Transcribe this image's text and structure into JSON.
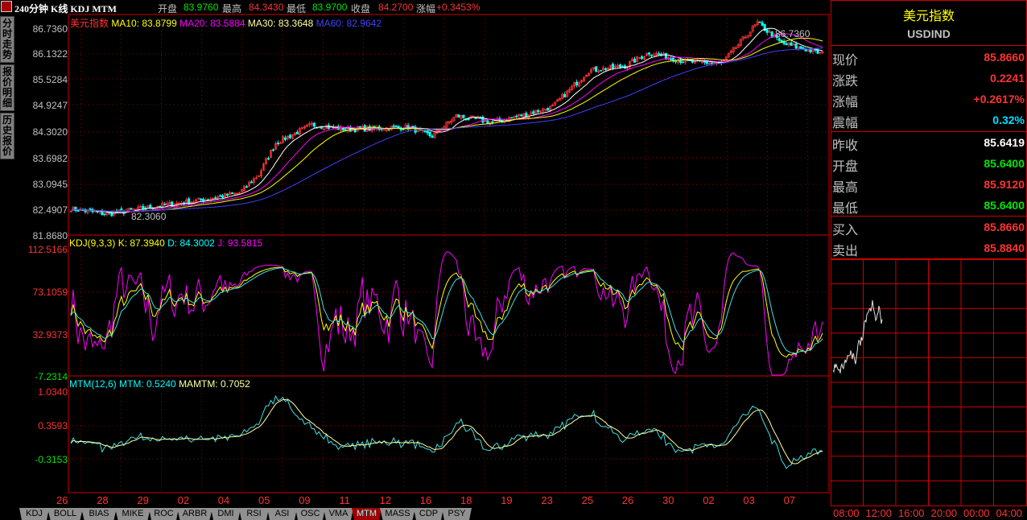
{
  "header": {
    "title": "240分钟 K线 KDJ MTM",
    "open_label": "开盘",
    "open": "83.9760",
    "high_label": "最高",
    "high": "84.3430",
    "low_label": "最低",
    "low": "83.9700",
    "close_label": "收盘",
    "close": "84.2700",
    "change_label": "涨幅",
    "change": "+0.3453%"
  },
  "side_tabs": [
    "分时走势",
    "报价明细",
    "历史报价"
  ],
  "price_panel": {
    "name": "美元指数",
    "ma10": "MA10: 83.8799",
    "ma20": "MA20: 83.5884",
    "ma30": "MA30: 83.3648",
    "ma60": "MA60: 82.9642",
    "axis": [
      "86.7360",
      "86.1322",
      "85.5284",
      "84.9247",
      "84.3020",
      "83.6982",
      "83.0945",
      "82.4907",
      "81.8680"
    ],
    "high_marker": "86.7360",
    "low_marker": "82.3060"
  },
  "kdj_panel": {
    "title": "KDJ(9,3,3)",
    "k": "K: 87.3940",
    "d": "D: 84.3002",
    "j": "J: 93.5815",
    "axis": [
      "112.5166",
      "73.1059",
      "32.9373",
      "-7.2314"
    ]
  },
  "mtm_panel": {
    "title": "MTM(12,6)",
    "mtm": "MTM: 0.5240",
    "mamtm": "MAMTM: 0.7052",
    "axis": [
      "1.0340",
      "0.3593",
      "-0.3153"
    ]
  },
  "dates": [
    "26",
    "28",
    "29",
    "02",
    "04",
    "05",
    "09",
    "11",
    "12",
    "16",
    "18",
    "19",
    "23",
    "25",
    "26",
    "30",
    "02",
    "03",
    "07"
  ],
  "indicator_tabs": [
    "KDJ",
    "BOLL",
    "BIAS",
    "MIKE",
    "ROC",
    "ARBR",
    "DMI",
    "RSI",
    "ASI",
    "OSC",
    "VMA",
    "MTM",
    "MASS",
    "CDP",
    "PSY"
  ],
  "active_tab": "MTM",
  "quote": {
    "name": "美元指数",
    "code": "USDIND",
    "rows": [
      {
        "k": "现价",
        "v": "85.8660",
        "c": "#ff3232"
      },
      {
        "k": "涨跌",
        "v": "0.2241",
        "c": "#ff3232"
      },
      {
        "k": "涨幅",
        "v": "+0.2617%",
        "c": "#ff3232"
      },
      {
        "k": "震幅",
        "v": "0.32%",
        "c": "#00e0ff"
      },
      {
        "k": "昨收",
        "v": "85.6419",
        "c": "#ffffff"
      },
      {
        "k": "开盘",
        "v": "85.6400",
        "c": "#00e600"
      },
      {
        "k": "最高",
        "v": "85.9120",
        "c": "#ff3232"
      },
      {
        "k": "最低",
        "v": "85.6400",
        "c": "#00e600"
      },
      {
        "k": "买入",
        "v": "85.8660",
        "c": "#ff3232"
      },
      {
        "k": "卖出",
        "v": "85.8840",
        "c": "#ff3232"
      }
    ]
  },
  "mini_times": [
    "08:00",
    "12:00",
    "16:00",
    "20:00",
    "00:00",
    "04:00"
  ],
  "chart_data": {
    "type": "candlestick",
    "price_range": [
      81.868,
      86.736
    ],
    "kdj_range": [
      -7.2314,
      112.5166
    ],
    "mtm_range": [
      -1.0,
      1.034
    ],
    "price_path": [
      [
        0,
        82.45
      ],
      [
        15,
        82.33
      ],
      [
        35,
        82.5
      ],
      [
        55,
        82.65
      ],
      [
        70,
        82.8
      ],
      [
        78,
        83.2
      ],
      [
        85,
        83.9
      ],
      [
        100,
        84.3
      ],
      [
        115,
        84.2
      ],
      [
        140,
        84.25
      ],
      [
        150,
        84.05
      ],
      [
        160,
        84.5
      ],
      [
        175,
        84.35
      ],
      [
        190,
        84.55
      ],
      [
        200,
        84.7
      ],
      [
        215,
        85.5
      ],
      [
        230,
        85.6
      ],
      [
        240,
        85.9
      ],
      [
        255,
        85.7
      ],
      [
        270,
        85.65
      ],
      [
        285,
        86.55
      ],
      [
        295,
        86.1
      ],
      [
        312,
        85.87
      ]
    ],
    "colors": {
      "up": "#ff3232",
      "down": "#00ffff",
      "ma10": "#ffffff",
      "ma20": "#ff00ff",
      "ma30": "#ffff00",
      "ma60": "#4040ff",
      "k": "#ffffff",
      "d": "#ffff00",
      "j": "#ff00ff"
    }
  }
}
